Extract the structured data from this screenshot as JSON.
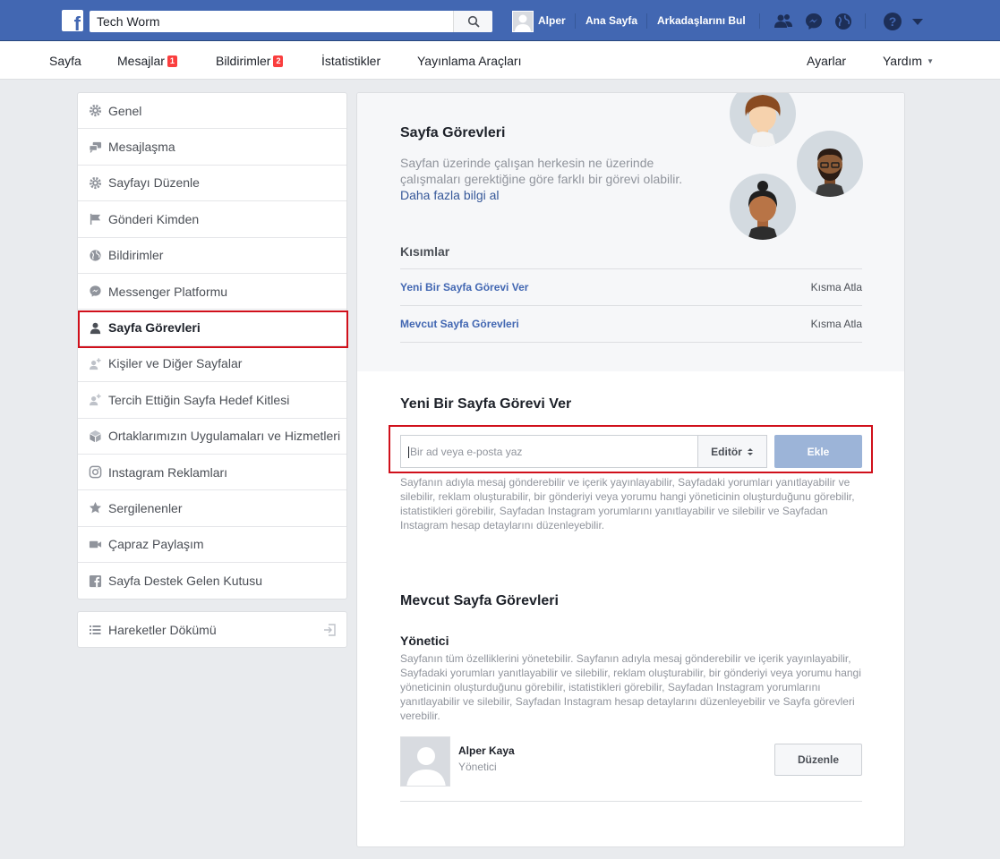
{
  "topbar": {
    "search_value": "Tech Worm",
    "user_name": "Alper",
    "home_label": "Ana Sayfa",
    "find_friends_label": "Arkadaşlarını Bul"
  },
  "pagenav": {
    "items": [
      {
        "label": "Sayfa"
      },
      {
        "label": "Mesajlar",
        "badge": "1"
      },
      {
        "label": "Bildirimler",
        "badge": "2"
      },
      {
        "label": "İstatistikler"
      },
      {
        "label": "Yayınlama Araçları"
      }
    ],
    "settings_label": "Ayarlar",
    "help_label": "Yardım"
  },
  "menu": {
    "items": [
      {
        "label": "Genel",
        "icon": "gear-icon"
      },
      {
        "label": "Mesajlaşma",
        "icon": "chat-icon"
      },
      {
        "label": "Sayfayı Düzenle",
        "icon": "gear-icon"
      },
      {
        "label": "Gönderi Kimden",
        "icon": "flag-icon"
      },
      {
        "label": "Bildirimler",
        "icon": "globe-icon"
      },
      {
        "label": "Messenger Platformu",
        "icon": "messenger-icon"
      },
      {
        "label": "Sayfa Görevleri",
        "icon": "person-icon",
        "active": true
      },
      {
        "label": "Kişiler ve Diğer Sayfalar",
        "icon": "person-add-icon"
      },
      {
        "label": "Tercih Ettiğin Sayfa Hedef Kitlesi",
        "icon": "person-add-icon"
      },
      {
        "label": "Ortaklarımızın Uygulamaları ve Hizmetleri",
        "icon": "cube-icon"
      },
      {
        "label": "Instagram Reklamları",
        "icon": "instagram-icon"
      },
      {
        "label": "Sergilenenler",
        "icon": "star-icon"
      },
      {
        "label": "Çapraz Paylaşım",
        "icon": "video-icon"
      },
      {
        "label": "Sayfa Destek Gelen Kutusu",
        "icon": "facebook-icon"
      }
    ],
    "activity_log_label": "Hareketler Dökümü"
  },
  "main": {
    "title": "Sayfa Görevleri",
    "description": "Sayfan üzerinde çalışan herkesin ne üzerinde çalışmaları gerektiğine göre farklı bir görevi olabilir.",
    "learn_more": "Daha fazla bilgi al",
    "sections_label": "Kısımlar",
    "sections": [
      {
        "label": "Yeni Bir Sayfa Görevi Ver",
        "skip": "Kısma Atla"
      },
      {
        "label": "Mevcut Sayfa Görevleri",
        "skip": "Kısma Atla"
      }
    ],
    "assign": {
      "title": "Yeni Bir Sayfa Görevi Ver",
      "placeholder": "Bir ad veya e-posta yaz",
      "role": "Editör",
      "add_label": "Ekle",
      "description": "Sayfanın adıyla mesaj gönderebilir ve içerik yayınlayabilir, Sayfadaki yorumları yanıtlayabilir ve silebilir, reklam oluşturabilir, bir gönderiyi veya yorumu hangi yöneticinin oluşturduğunu görebilir, istatistikleri görebilir, Sayfadan Instagram yorumlarını yanıtlayabilir ve silebilir ve Sayfadan Instagram hesap detaylarını düzenleyebilir."
    },
    "existing": {
      "title": "Mevcut Sayfa Görevleri",
      "admin_label": "Yönetici",
      "admin_description": "Sayfanın tüm özelliklerini yönetebilir. Sayfanın adıyla mesaj gönderebilir ve içerik yayınlayabilir, Sayfadaki yorumları yanıtlayabilir ve silebilir, reklam oluşturabilir, bir gönderiyi veya yorumu hangi yöneticinin oluşturduğunu görebilir, istatistikleri görebilir, Sayfadan Instagram yorumlarını yanıtlayabilir ve silebilir, Sayfadan Instagram hesap detaylarını düzenleyebilir ve Sayfa görevleri verebilir.",
      "user_name": "Alper Kaya",
      "user_role": "Yönetici",
      "edit_label": "Düzenle"
    }
  },
  "colors": {
    "brand_blue": "#4267b2",
    "link_blue": "#365899",
    "highlight_red": "#d0101b",
    "badge_red": "#fa3e3e"
  }
}
